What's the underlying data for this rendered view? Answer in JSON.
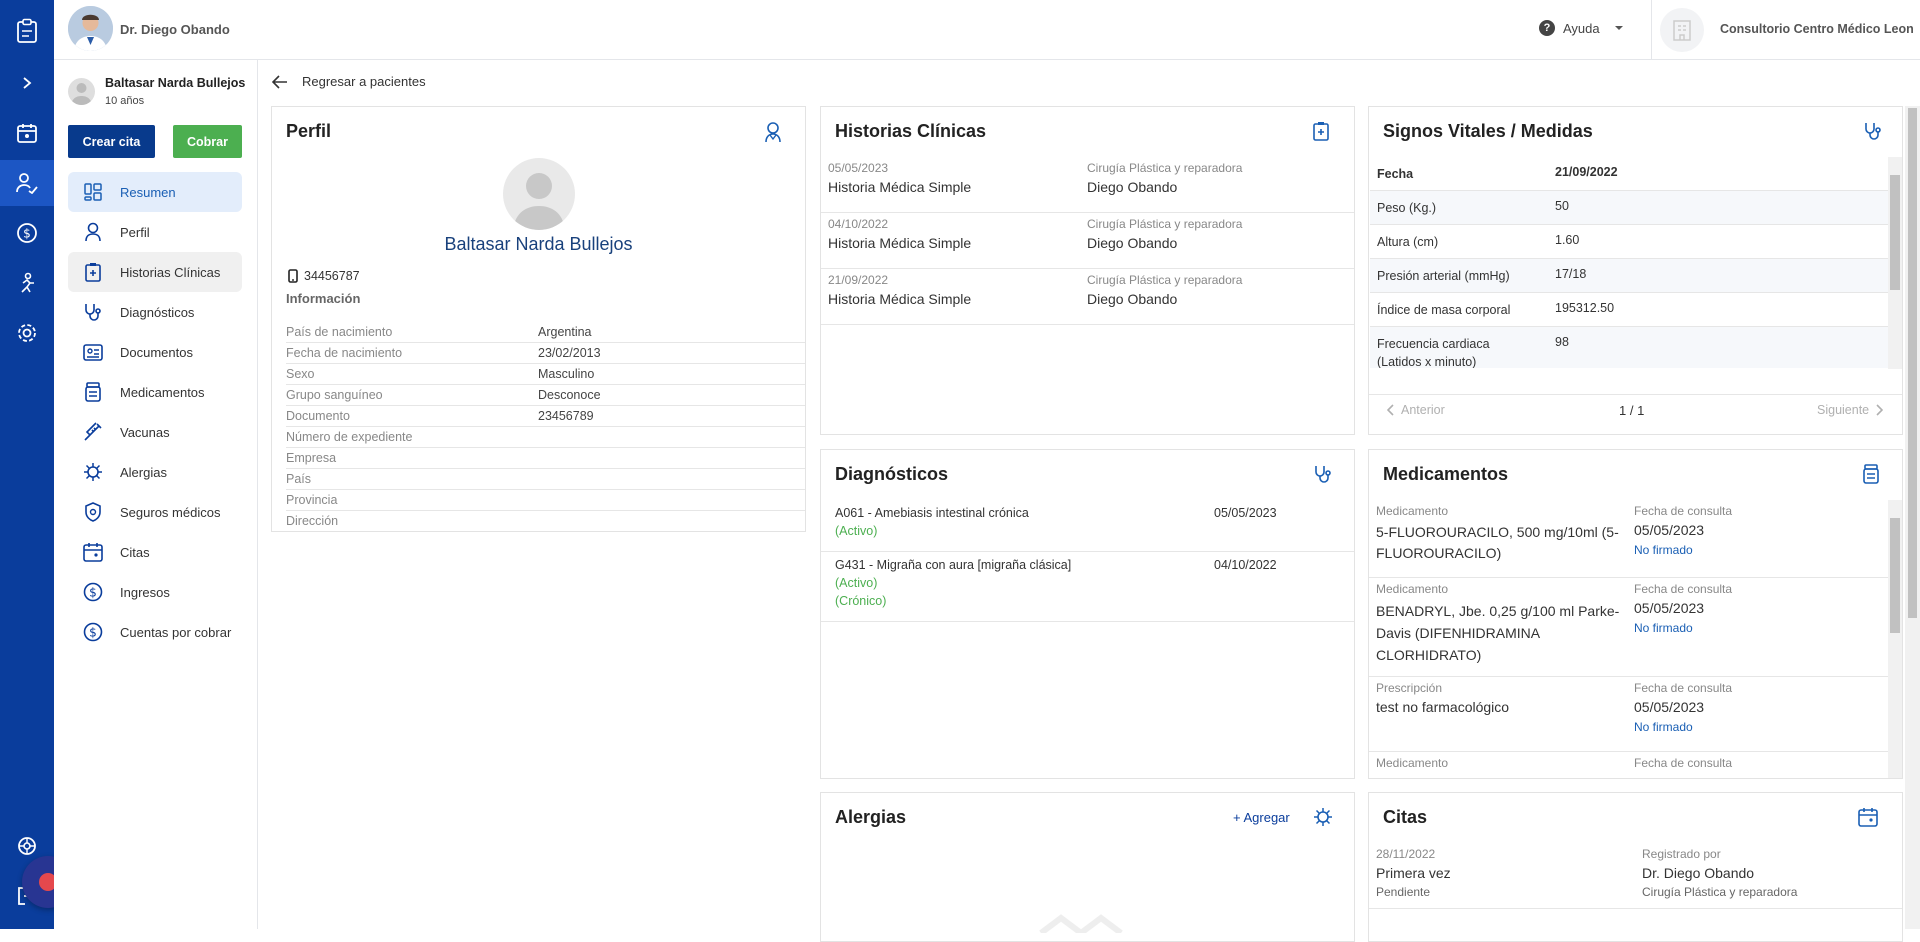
{
  "topbar": {
    "doctor_name": "Dr. Diego Obando",
    "help_label": "Ayuda",
    "clinic_name": "Consultorio Centro Médico Leon"
  },
  "rail": {
    "icons": [
      "clipboard-icon",
      "chevron-right-icon",
      "calendar-icon",
      "patients-icon",
      "dollar-icon",
      "run-icon",
      "settings-icon"
    ],
    "bottom_icons": [
      "support-icon",
      "logout-icon"
    ]
  },
  "patient": {
    "name": "Baltasar Narda Bullejos",
    "age": "10 años"
  },
  "actions": {
    "create_appointment": "Crear cita",
    "charge": "Cobrar"
  },
  "nav": [
    {
      "label": "Resumen",
      "icon": "dashboard-icon"
    },
    {
      "label": "Perfil",
      "icon": "user-icon"
    },
    {
      "label": "Historias Clínicas",
      "icon": "medical-record-icon"
    },
    {
      "label": "Diagnósticos",
      "icon": "stethoscope-icon"
    },
    {
      "label": "Documentos",
      "icon": "documents-icon"
    },
    {
      "label": "Medicamentos",
      "icon": "medicine-icon"
    },
    {
      "label": "Vacunas",
      "icon": "syringe-icon"
    },
    {
      "label": "Alergias",
      "icon": "allergy-icon"
    },
    {
      "label": "Seguros médicos",
      "icon": "shield-icon"
    },
    {
      "label": "Citas",
      "icon": "calendar-icon"
    },
    {
      "label": "Ingresos",
      "icon": "dollar-icon"
    },
    {
      "label": "Cuentas por cobrar",
      "icon": "dollar-icon"
    }
  ],
  "back_label": "Regresar a pacientes",
  "profile": {
    "title": "Perfil",
    "name": "Baltasar Narda Bullejos",
    "phone": "34456787",
    "info_title": "Información",
    "rows": [
      {
        "k": "País de nacimiento",
        "v": "Argentina"
      },
      {
        "k": "Fecha de nacimiento",
        "v": "23/02/2013"
      },
      {
        "k": "Sexo",
        "v": "Masculino"
      },
      {
        "k": "Grupo sanguíneo",
        "v": "Desconoce"
      },
      {
        "k": "Documento",
        "v": "23456789"
      },
      {
        "k": "Número de expediente",
        "v": ""
      },
      {
        "k": "Empresa",
        "v": ""
      },
      {
        "k": "País",
        "v": ""
      },
      {
        "k": "Provincia",
        "v": ""
      },
      {
        "k": "Dirección",
        "v": ""
      }
    ]
  },
  "histories": {
    "title": "Historias Clínicas",
    "rows": [
      {
        "date": "05/05/2023",
        "type": "Historia Médica Simple",
        "specialty": "Cirugía Plástica y reparadora",
        "doctor": "Diego Obando"
      },
      {
        "date": "04/10/2022",
        "type": "Historia Médica Simple",
        "specialty": "Cirugía Plástica y reparadora",
        "doctor": "Diego Obando"
      },
      {
        "date": "21/09/2022",
        "type": "Historia Médica Simple",
        "specialty": "Cirugía Plástica y reparadora",
        "doctor": "Diego Obando"
      }
    ]
  },
  "vitals": {
    "title": "Signos Vitales / Medidas",
    "head": {
      "k": "Fecha",
      "v": "21/09/2022"
    },
    "rows": [
      {
        "k": "Peso (Kg.)",
        "v": "50"
      },
      {
        "k": "Altura (cm)",
        "v": "1.60"
      },
      {
        "k": "Presión arterial (mmHg)",
        "v": "17/18"
      },
      {
        "k": "Índice de masa corporal",
        "v": "195312.50"
      },
      {
        "k": "Frecuencia cardiaca (Latidos x minuto)",
        "v": "98"
      }
    ],
    "prev": "Anterior",
    "page": "1 / 1",
    "next": "Siguiente"
  },
  "diagnoses": {
    "title": "Diagnósticos",
    "rows": [
      {
        "name": "A061 - Amebiasis intestinal crónica",
        "date": "05/05/2023",
        "tags": [
          "(Activo)"
        ]
      },
      {
        "name": "G431 - Migraña con aura [migraña clásica]",
        "date": "04/10/2022",
        "tags": [
          "(Activo)",
          "(Crónico)"
        ]
      }
    ]
  },
  "medications": {
    "title": "Medicamentos",
    "consult_label": "Fecha de consulta",
    "rows": [
      {
        "kind": "Medicamento",
        "name": "5-FLUOROURACILO, 500 mg/10ml (5-FLUOROURACILO)",
        "date": "05/05/2023",
        "status": "No firmado"
      },
      {
        "kind": "Medicamento",
        "name": "BENADRYL, Jbe. 0,25 g/100 ml Parke-Davis (DIFENHIDRAMINA CLORHIDRATO)",
        "date": "05/05/2023",
        "status": "No firmado"
      },
      {
        "kind": "Prescripción",
        "name": "test no farmacológico",
        "date": "05/05/2023",
        "status": "No firmado"
      },
      {
        "kind": "Medicamento",
        "name": "",
        "date": "",
        "status": ""
      }
    ]
  },
  "allergies": {
    "title": "Alergias",
    "add_label": "+ Agregar"
  },
  "appointments": {
    "title": "Citas",
    "rows": [
      {
        "date": "28/11/2022",
        "type": "Primera vez",
        "status": "Pendiente",
        "by_label": "Registrado por",
        "doctor": "Dr. Diego Obando",
        "specialty": "Cirugía Plástica y reparadora"
      }
    ]
  },
  "colors": {
    "rail": "#0a3d9c",
    "primary": "#083a8c",
    "success": "#4caf50",
    "link": "#1a5fb4"
  }
}
